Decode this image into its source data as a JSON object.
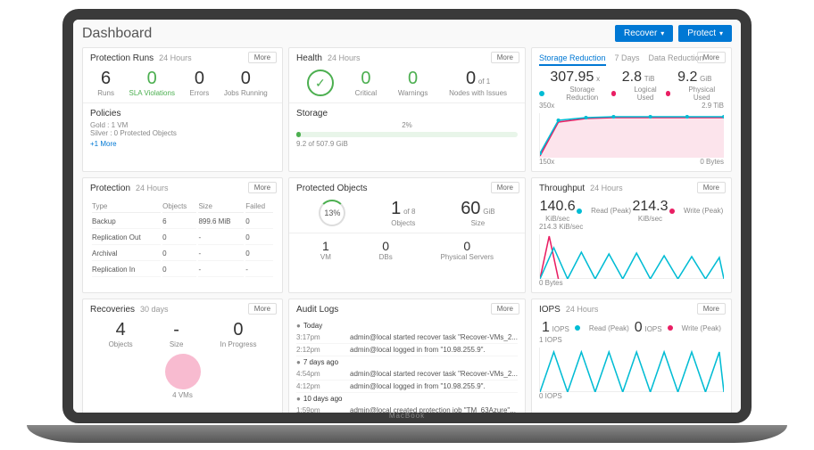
{
  "header": {
    "title": "Dashboard",
    "recover_label": "Recover",
    "protect_label": "Protect"
  },
  "protection_runs": {
    "title": "Protection Runs",
    "period": "24 Hours",
    "more": "More",
    "runs_num": "6",
    "runs_lbl": "Runs",
    "sla_num": "0",
    "sla_lbl": "SLA Violations",
    "err_num": "0",
    "err_lbl": "Errors",
    "jobs_num": "0",
    "jobs_lbl": "Jobs Running",
    "policies_title": "Policies",
    "gold": "Gold : 1 VM",
    "silver": "Silver : 0 Protected Objects",
    "more_link": "+1 More"
  },
  "health": {
    "title": "Health",
    "period": "24 Hours",
    "more": "More",
    "crit_num": "0",
    "crit_lbl": "Critical",
    "warn_num": "0",
    "warn_lbl": "Warnings",
    "nodes_num": "0",
    "nodes_of": "of 1",
    "nodes_lbl": "Nodes with Issues",
    "storage_title": "Storage",
    "storage_pct": "2%",
    "storage_used": "9.2 of 507.9 GiB"
  },
  "storage_reduction": {
    "tab1": "Storage Reduction",
    "period": "7 Days",
    "tab2": "Data Reduction",
    "more": "More",
    "v1": "307.95",
    "u1": "x",
    "l1": "Storage Reduction",
    "v2": "2.8",
    "u2": "TiB",
    "l2": "Logical Used",
    "v3": "9.2",
    "u3": "GiB",
    "l3": "Physical Used",
    "ymax": "350x",
    "yright_top": "2.9 TiB",
    "ymin": "150x",
    "yright_bot": "0 Bytes"
  },
  "protection": {
    "title": "Protection",
    "period": "24 Hours",
    "more": "More",
    "cols": {
      "type": "Type",
      "objects": "Objects",
      "size": "Size",
      "failed": "Failed"
    },
    "rows": [
      {
        "type": "Backup",
        "objects": "6",
        "size": "899.6 MiB",
        "failed": "0"
      },
      {
        "type": "Replication Out",
        "objects": "0",
        "size": "-",
        "failed": "0"
      },
      {
        "type": "Archival",
        "objects": "0",
        "size": "-",
        "failed": "0"
      },
      {
        "type": "Replication In",
        "objects": "0",
        "size": "-",
        "failed": "-"
      }
    ]
  },
  "protected_objects": {
    "title": "Protected Objects",
    "more": "More",
    "pct": "13%",
    "main_num": "1",
    "main_of": "of 8",
    "main_lbl": "Objects",
    "size_num": "60",
    "size_unit": "GiB",
    "size_lbl": "Size",
    "vm_num": "1",
    "vm_lbl": "VM",
    "db_num": "0",
    "db_lbl": "DBs",
    "ps_num": "0",
    "ps_lbl": "Physical Servers"
  },
  "throughput": {
    "title": "Throughput",
    "period": "24 Hours",
    "more": "More",
    "read_num": "140.6",
    "read_unit": "KiB/sec",
    "read_lbl": "Read (Peak)",
    "write_num": "214.3",
    "write_unit": "KiB/sec",
    "write_lbl": "Write (Peak)",
    "ymax": "214.3 KiB/sec",
    "ymin": "0 Bytes"
  },
  "recoveries": {
    "title": "Recoveries",
    "period": "30 days",
    "more": "More",
    "obj_num": "4",
    "obj_lbl": "Objects",
    "size_num": "-",
    "size_lbl": "Size",
    "prog_num": "0",
    "prog_lbl": "In Progress",
    "legend": "4 VMs"
  },
  "audit": {
    "title": "Audit Logs",
    "more": "More",
    "groups": [
      {
        "label": "Today",
        "rows": [
          {
            "t": "3:17pm",
            "m": "admin@local started recover task \"Recover-VMs_2..."
          },
          {
            "t": "2:12pm",
            "m": "admin@local logged in from \"10.98.255.9\"."
          }
        ]
      },
      {
        "label": "7 days ago",
        "rows": [
          {
            "t": "4:54pm",
            "m": "admin@local started recover task \"Recover-VMs_2..."
          },
          {
            "t": "4:12pm",
            "m": "admin@local logged in from \"10.98.255.9\"."
          }
        ]
      },
      {
        "label": "10 days ago",
        "rows": [
          {
            "t": "1:59pm",
            "m": "admin@local created protection job \"TM_63Azure\"..."
          }
        ]
      }
    ]
  },
  "iops": {
    "title": "IOPS",
    "period": "24 Hours",
    "more": "More",
    "read_num": "1",
    "read_unit": "IOPS",
    "read_lbl": "Read (Peak)",
    "write_num": "0",
    "write_unit": "IOPS",
    "write_lbl": "Write (Peak)",
    "ymax": "1 IOPS",
    "ymin": "0 IOPS"
  },
  "chart_data": [
    {
      "type": "line",
      "title": "Storage Reduction",
      "series": [
        {
          "name": "Storage Reduction (x)",
          "values": [
            150,
            310,
            320,
            320,
            320,
            320,
            320
          ]
        },
        {
          "name": "Logical Used (TiB)",
          "values": [
            0.8,
            2.4,
            2.6,
            2.7,
            2.8,
            2.8,
            2.8
          ]
        }
      ],
      "ylim_left": [
        150,
        350
      ],
      "ylim_right": [
        0,
        2.9
      ]
    },
    {
      "type": "line",
      "title": "Throughput",
      "series": [
        {
          "name": "Read KiB/sec",
          "values": [
            0,
            140,
            0,
            100,
            0,
            90,
            0,
            95,
            0,
            85,
            0
          ]
        },
        {
          "name": "Write KiB/sec",
          "values": [
            0,
            214,
            0,
            0,
            0,
            0,
            0,
            0,
            0,
            0,
            0
          ]
        }
      ],
      "ylim": [
        0,
        214.3
      ]
    },
    {
      "type": "line",
      "title": "IOPS",
      "series": [
        {
          "name": "Read IOPS",
          "values": [
            0,
            1,
            0,
            1,
            0,
            1,
            0,
            1,
            0,
            1,
            0
          ]
        }
      ],
      "ylim": [
        0,
        1
      ]
    },
    {
      "type": "bar",
      "title": "Storage",
      "categories": [
        "Used"
      ],
      "values": [
        2
      ],
      "ylim": [
        0,
        100
      ]
    },
    {
      "type": "pie",
      "title": "Recoveries",
      "categories": [
        "VMs"
      ],
      "values": [
        4
      ]
    }
  ]
}
